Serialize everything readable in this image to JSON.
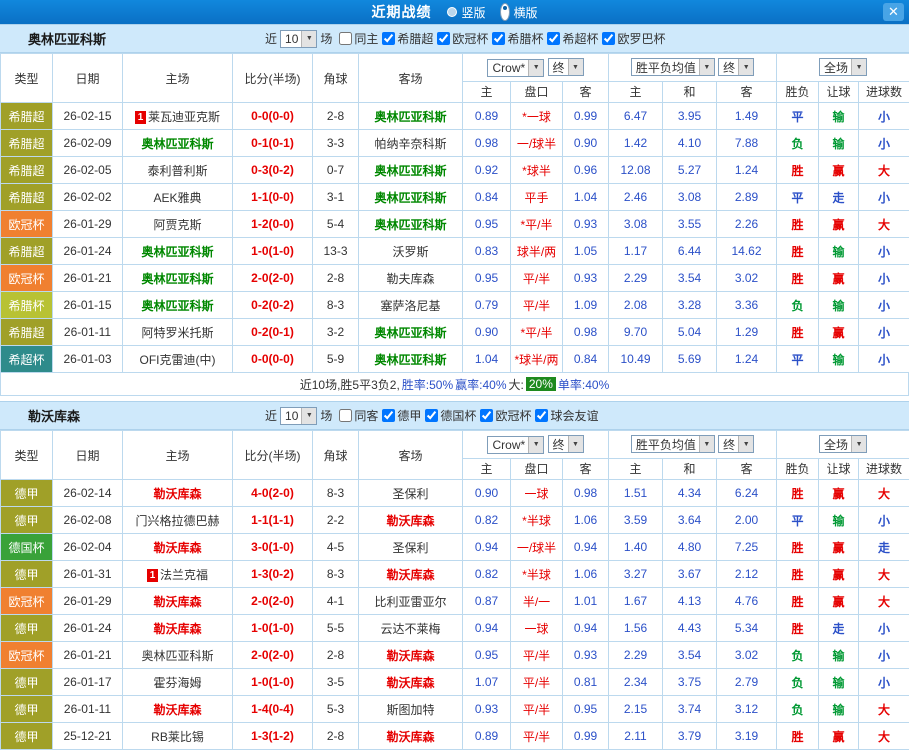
{
  "topbar": {
    "title": "近期战绩",
    "view_options": [
      {
        "label": "竖版",
        "selected": false
      },
      {
        "label": "横版",
        "selected": true
      }
    ],
    "close_icon": "✕"
  },
  "type_colors": {
    "希腊超": "#a0a028",
    "欧冠杯": "#f08030",
    "希腊杯": "#b8c234",
    "希超杯": "#2e8b8b",
    "德甲": "#a0a028",
    "德国杯": "#39a239"
  },
  "result_colors": {
    "胜": "#e60000",
    "赢": "#e60000",
    "大": "#e60000",
    "平": "#2b50c8",
    "走": "#2b50c8",
    "小": "#2b50c8",
    "负": "#009933",
    "输": "#009933"
  },
  "sections": [
    {
      "team": "奥林匹亚科斯",
      "highlight_color": "#008800",
      "near_label": "近",
      "count": "10",
      "games_label": "场",
      "filters": [
        {
          "label": "同主",
          "checked": false
        },
        {
          "label": "希腊超",
          "checked": true
        },
        {
          "label": "欧冠杯",
          "checked": true
        },
        {
          "label": "希腊杯",
          "checked": true
        },
        {
          "label": "希超杯",
          "checked": true
        },
        {
          "label": "欧罗巴杯",
          "checked": true
        }
      ],
      "selects": {
        "asia": "Crow*",
        "asia_final": "终",
        "europe": "胜平负均值",
        "europe_final": "终",
        "scope": "全场"
      },
      "headers": {
        "type": "类型",
        "date": "日期",
        "home": "主场",
        "score": "比分(半场)",
        "corner": "角球",
        "away": "客场",
        "asia": [
          "主",
          "盘口",
          "客"
        ],
        "europe": [
          "主",
          "和",
          "客"
        ],
        "result": [
          "胜负",
          "让球",
          "进球数"
        ]
      },
      "rows": [
        {
          "type": "希腊超",
          "date": "26-02-15",
          "card": "1",
          "home": "莱瓦迪亚克斯",
          "home_hl": false,
          "score": "0-0(0-0)",
          "corner": "2-8",
          "away": "奥林匹亚科斯",
          "away_hl": true,
          "asia": [
            "0.89",
            "*一球",
            "0.99"
          ],
          "europe": [
            "6.47",
            "3.95",
            "1.49"
          ],
          "results": [
            "平",
            "输",
            "小"
          ]
        },
        {
          "type": "希腊超",
          "date": "26-02-09",
          "home": "奥林匹亚科斯",
          "home_hl": true,
          "score": "0-1(0-1)",
          "corner": "3-3",
          "away": "帕纳辛奈科斯",
          "away_hl": false,
          "asia": [
            "0.98",
            "一/球半",
            "0.90"
          ],
          "europe": [
            "1.42",
            "4.10",
            "7.88"
          ],
          "results": [
            "负",
            "输",
            "小"
          ]
        },
        {
          "type": "希腊超",
          "date": "26-02-05",
          "home": "泰利普利斯",
          "home_hl": false,
          "score": "0-3(0-2)",
          "corner": "0-7",
          "away": "奥林匹亚科斯",
          "away_hl": true,
          "asia": [
            "0.92",
            "*球半",
            "0.96"
          ],
          "europe": [
            "12.08",
            "5.27",
            "1.24"
          ],
          "results": [
            "胜",
            "赢",
            "大"
          ]
        },
        {
          "type": "希腊超",
          "date": "26-02-02",
          "home": "AEK雅典",
          "home_hl": false,
          "score": "1-1(0-0)",
          "corner": "3-1",
          "away": "奥林匹亚科斯",
          "away_hl": true,
          "asia": [
            "0.84",
            "平手",
            "1.04"
          ],
          "europe": [
            "2.46",
            "3.08",
            "2.89"
          ],
          "results": [
            "平",
            "走",
            "小"
          ]
        },
        {
          "type": "欧冠杯",
          "date": "26-01-29",
          "home": "阿贾克斯",
          "home_hl": false,
          "score": "1-2(0-0)",
          "corner": "5-4",
          "away": "奥林匹亚科斯",
          "away_hl": true,
          "asia": [
            "0.95",
            "*平/半",
            "0.93"
          ],
          "europe": [
            "3.08",
            "3.55",
            "2.26"
          ],
          "results": [
            "胜",
            "赢",
            "大"
          ]
        },
        {
          "type": "希腊超",
          "date": "26-01-24",
          "home": "奥林匹亚科斯",
          "home_hl": true,
          "score": "1-0(1-0)",
          "corner": "13-3",
          "away": "沃罗斯",
          "away_hl": false,
          "asia": [
            "0.83",
            "球半/两",
            "1.05"
          ],
          "europe": [
            "1.17",
            "6.44",
            "14.62"
          ],
          "results": [
            "胜",
            "输",
            "小"
          ]
        },
        {
          "type": "欧冠杯",
          "date": "26-01-21",
          "home": "奥林匹亚科斯",
          "home_hl": true,
          "score": "2-0(2-0)",
          "corner": "2-8",
          "away": "勒夫库森",
          "away_hl": false,
          "asia": [
            "0.95",
            "平/半",
            "0.93"
          ],
          "europe": [
            "2.29",
            "3.54",
            "3.02"
          ],
          "results": [
            "胜",
            "赢",
            "小"
          ]
        },
        {
          "type": "希腊杯",
          "date": "26-01-15",
          "home": "奥林匹亚科斯",
          "home_hl": true,
          "score": "0-2(0-2)",
          "corner": "8-3",
          "away": "塞萨洛尼基",
          "away_hl": false,
          "asia": [
            "0.79",
            "平/半",
            "1.09"
          ],
          "europe": [
            "2.08",
            "3.28",
            "3.36"
          ],
          "results": [
            "负",
            "输",
            "小"
          ]
        },
        {
          "type": "希腊超",
          "date": "26-01-11",
          "home": "阿特罗米托斯",
          "home_hl": false,
          "score": "0-2(0-1)",
          "corner": "3-2",
          "away": "奥林匹亚科斯",
          "away_hl": true,
          "asia": [
            "0.90",
            "*平/半",
            "0.98"
          ],
          "europe": [
            "9.70",
            "5.04",
            "1.29"
          ],
          "results": [
            "胜",
            "赢",
            "小"
          ]
        },
        {
          "type": "希超杯",
          "date": "26-01-03",
          "home": "OFI克雷迪(中)",
          "home_hl": false,
          "score": "0-0(0-0)",
          "corner": "5-9",
          "away": "奥林匹亚科斯",
          "away_hl": true,
          "asia": [
            "1.04",
            "*球半/两",
            "0.84"
          ],
          "europe": [
            "10.49",
            "5.69",
            "1.24"
          ],
          "results": [
            "平",
            "输",
            "小"
          ]
        }
      ],
      "summary": {
        "parts": [
          {
            "text": "近10场,胜5平3负2, ",
            "color": "#333333"
          },
          {
            "text": "胜率:50%",
            "color": "#2b50c8"
          },
          {
            "text": " 赢率:40%",
            "color": "#2b50c8"
          },
          {
            "text": " 大:",
            "color": "#333333"
          },
          {
            "text": "20%",
            "badge": true
          },
          {
            "text": " 单率:40%",
            "color": "#2b50c8"
          }
        ]
      }
    },
    {
      "team": "勒沃库森",
      "highlight_color": "#e60000",
      "near_label": "近",
      "count": "10",
      "games_label": "场",
      "filters": [
        {
          "label": "同客",
          "checked": false
        },
        {
          "label": "德甲",
          "checked": true
        },
        {
          "label": "德国杯",
          "checked": true
        },
        {
          "label": "欧冠杯",
          "checked": true
        },
        {
          "label": "球会友谊",
          "checked": true
        }
      ],
      "selects": {
        "asia": "Crow*",
        "asia_final": "终",
        "europe": "胜平负均值",
        "europe_final": "终",
        "scope": "全场"
      },
      "headers": {
        "type": "类型",
        "date": "日期",
        "home": "主场",
        "score": "比分(半场)",
        "corner": "角球",
        "away": "客场",
        "asia": [
          "主",
          "盘口",
          "客"
        ],
        "europe": [
          "主",
          "和",
          "客"
        ],
        "result": [
          "胜负",
          "让球",
          "进球数"
        ]
      },
      "rows": [
        {
          "type": "德甲",
          "date": "26-02-14",
          "home": "勒沃库森",
          "home_hl": true,
          "score": "4-0(2-0)",
          "corner": "8-3",
          "away": "圣保利",
          "away_hl": false,
          "asia": [
            "0.90",
            "一球",
            "0.98"
          ],
          "europe": [
            "1.51",
            "4.34",
            "6.24"
          ],
          "results": [
            "胜",
            "赢",
            "大"
          ]
        },
        {
          "type": "德甲",
          "date": "26-02-08",
          "home": "门兴格拉德巴赫",
          "home_hl": false,
          "score": "1-1(1-1)",
          "corner": "2-2",
          "away": "勒沃库森",
          "away_hl": true,
          "asia": [
            "0.82",
            "*半球",
            "1.06"
          ],
          "europe": [
            "3.59",
            "3.64",
            "2.00"
          ],
          "results": [
            "平",
            "输",
            "小"
          ]
        },
        {
          "type": "德国杯",
          "date": "26-02-04",
          "home": "勒沃库森",
          "home_hl": true,
          "score": "3-0(1-0)",
          "corner": "4-5",
          "away": "圣保利",
          "away_hl": false,
          "asia": [
            "0.94",
            "一/球半",
            "0.94"
          ],
          "europe": [
            "1.40",
            "4.80",
            "7.25"
          ],
          "results": [
            "胜",
            "赢",
            "走"
          ]
        },
        {
          "type": "德甲",
          "date": "26-01-31",
          "card": "1",
          "home": "法兰克福",
          "home_hl": false,
          "score": "1-3(0-2)",
          "corner": "8-3",
          "away": "勒沃库森",
          "away_hl": true,
          "asia": [
            "0.82",
            "*半球",
            "1.06"
          ],
          "europe": [
            "3.27",
            "3.67",
            "2.12"
          ],
          "results": [
            "胜",
            "赢",
            "大"
          ]
        },
        {
          "type": "欧冠杯",
          "date": "26-01-29",
          "home": "勒沃库森",
          "home_hl": true,
          "score": "2-0(2-0)",
          "corner": "4-1",
          "away": "比利亚雷亚尔",
          "away_hl": false,
          "asia": [
            "0.87",
            "半/一",
            "1.01"
          ],
          "europe": [
            "1.67",
            "4.13",
            "4.76"
          ],
          "results": [
            "胜",
            "赢",
            "大"
          ]
        },
        {
          "type": "德甲",
          "date": "26-01-24",
          "home": "勒沃库森",
          "home_hl": true,
          "score": "1-0(1-0)",
          "corner": "5-5",
          "away": "云达不莱梅",
          "away_hl": false,
          "asia": [
            "0.94",
            "一球",
            "0.94"
          ],
          "europe": [
            "1.56",
            "4.43",
            "5.34"
          ],
          "results": [
            "胜",
            "走",
            "小"
          ]
        },
        {
          "type": "欧冠杯",
          "date": "26-01-21",
          "home": "奥林匹亚科斯",
          "home_hl": false,
          "score": "2-0(2-0)",
          "corner": "2-8",
          "away": "勒沃库森",
          "away_hl": true,
          "asia": [
            "0.95",
            "平/半",
            "0.93"
          ],
          "europe": [
            "2.29",
            "3.54",
            "3.02"
          ],
          "results": [
            "负",
            "输",
            "小"
          ]
        },
        {
          "type": "德甲",
          "date": "26-01-17",
          "home": "霍芬海姆",
          "home_hl": false,
          "score": "1-0(1-0)",
          "corner": "3-5",
          "away": "勒沃库森",
          "away_hl": true,
          "asia": [
            "1.07",
            "平/半",
            "0.81"
          ],
          "europe": [
            "2.34",
            "3.75",
            "2.79"
          ],
          "results": [
            "负",
            "输",
            "小"
          ]
        },
        {
          "type": "德甲",
          "date": "26-01-11",
          "home": "勒沃库森",
          "home_hl": true,
          "score": "1-4(0-4)",
          "corner": "5-3",
          "away": "斯图加特",
          "away_hl": false,
          "asia": [
            "0.93",
            "平/半",
            "0.95"
          ],
          "europe": [
            "2.15",
            "3.74",
            "3.12"
          ],
          "results": [
            "负",
            "输",
            "大"
          ]
        },
        {
          "type": "德甲",
          "date": "25-12-21",
          "home": "RB莱比锡",
          "home_hl": false,
          "score": "1-3(1-2)",
          "corner": "2-8",
          "away": "勒沃库森",
          "away_hl": true,
          "asia": [
            "0.89",
            "平/半",
            "0.99"
          ],
          "europe": [
            "2.11",
            "3.79",
            "3.19"
          ],
          "results": [
            "胜",
            "赢",
            "大"
          ]
        }
      ],
      "summary": null
    }
  ]
}
